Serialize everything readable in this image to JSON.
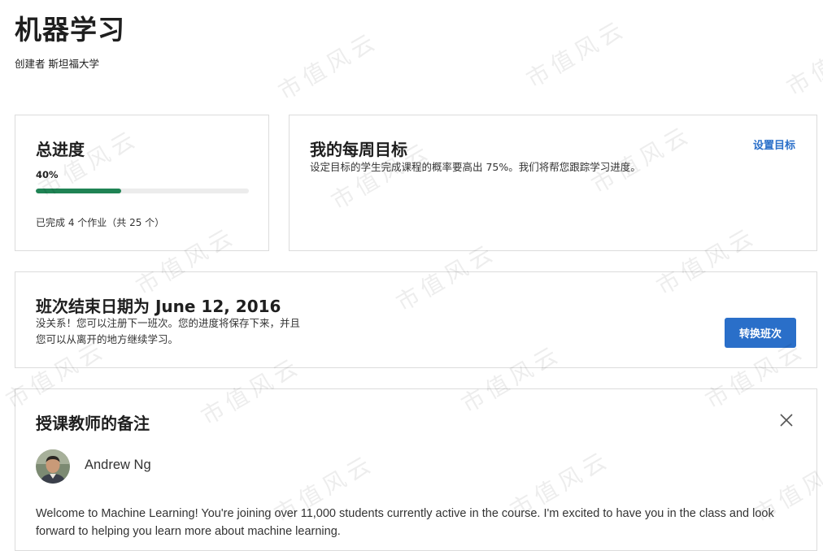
{
  "course": {
    "title": "机器学习",
    "creator": "创建者 斯坦福大学"
  },
  "progress": {
    "title": "总进度",
    "percent_label": "40%",
    "percent": 40,
    "completed_note": "已完成 4 个作业（共 25 个）"
  },
  "weekly_goal": {
    "title": "我的每周目标",
    "description": "设定目标的学生完成课程的概率要高出 75%。我们将帮您跟踪学习进度。",
    "set_goal_link": "设置目标"
  },
  "session": {
    "title": "班次结束日期为 June 12, 2016",
    "description_line1": "没关系！您可以注册下一班次。您的进度将保存下来，并且",
    "description_line2": "您可以从离开的地方继续学习。",
    "switch_button": "转换班次"
  },
  "instructor_notes": {
    "title": "授课教师的备注",
    "instructor_name": "Andrew Ng",
    "message": "Welcome to Machine Learning! You're joining over 11,000 students currently active in the course. I'm excited to have you in the class and look forward to helping you learn more about machine learning."
  },
  "watermark": {
    "text": "市值风云"
  },
  "colors": {
    "accent": "#2a6fc9",
    "progress_fill": "#1f8354",
    "progress_track": "#ececec",
    "border": "#dcdcdc"
  }
}
